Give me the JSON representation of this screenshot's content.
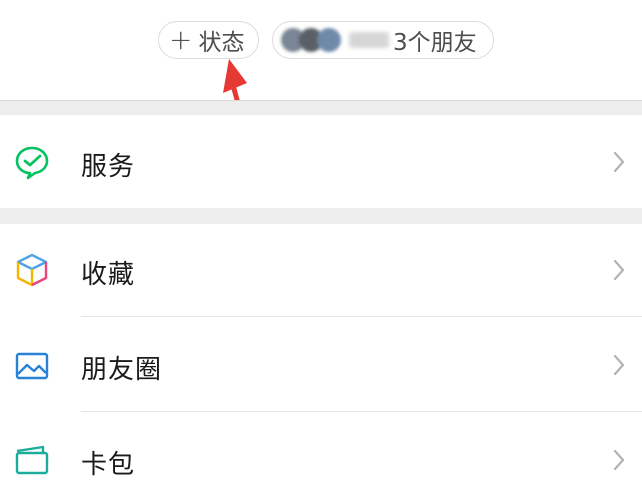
{
  "header": {
    "status_plus": "+",
    "status_label": "状态",
    "friends_count_label": "3个朋友"
  },
  "menu": {
    "items": [
      {
        "label": "服务",
        "icon": "services-check-icon"
      },
      {
        "label": "收藏",
        "icon": "favorites-cube-icon"
      },
      {
        "label": "朋友圈",
        "icon": "moments-picture-icon"
      },
      {
        "label": "卡包",
        "icon": "card-wallet-icon"
      }
    ]
  },
  "colors": {
    "services_green": "#07C160",
    "moments_blue": "#2782D7",
    "cards_teal": "#1AAD9B",
    "annotation_red": "#E53935",
    "separator": "#EDEDED"
  }
}
